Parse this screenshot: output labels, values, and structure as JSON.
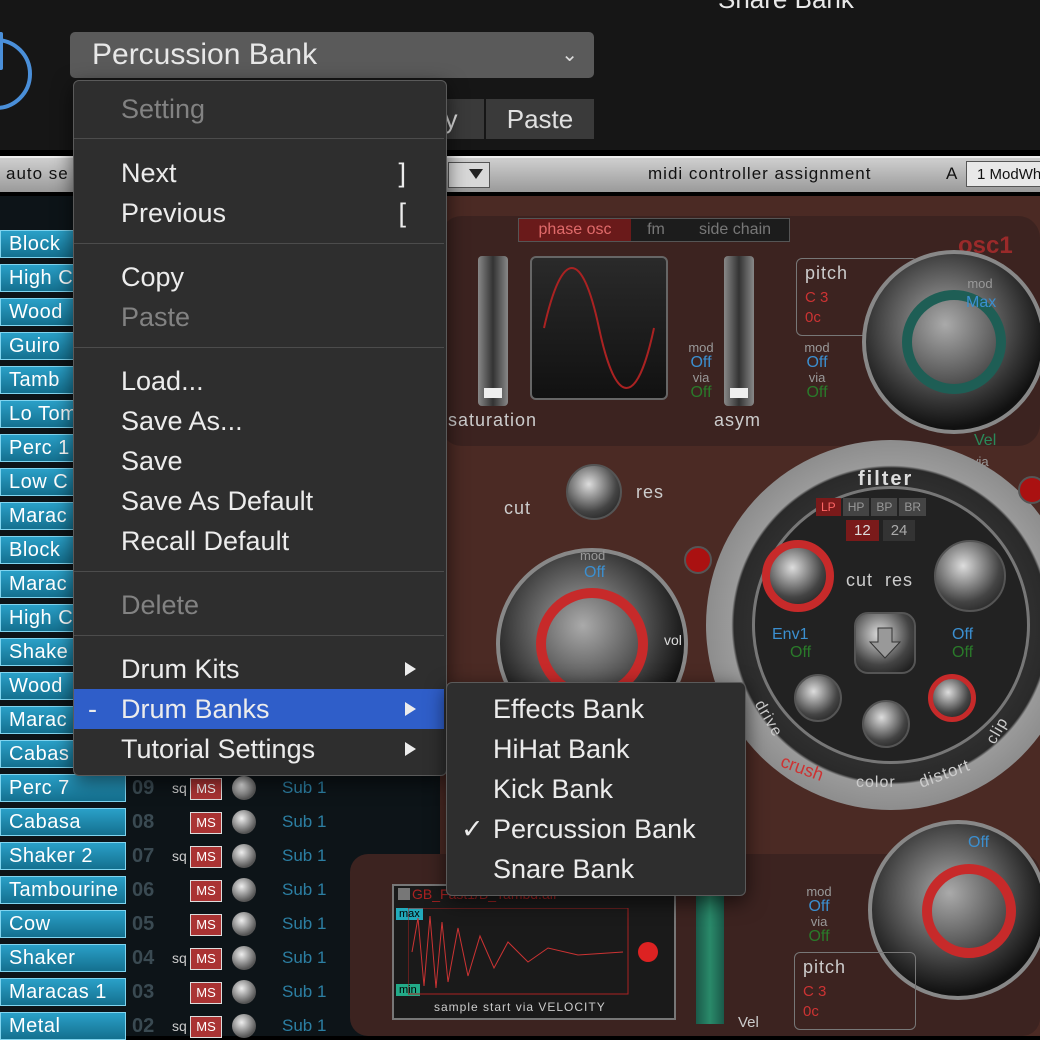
{
  "header": {
    "preset_name": "Percussion Bank",
    "snare_bank_top": "Snare Bank",
    "copy_label": "py",
    "paste_label": "Paste"
  },
  "toolbar": {
    "auto_select_label": "auto se",
    "midi_controller_label": "midi controller assignment",
    "midi_a_label": "A",
    "midi_controller_value": "1 ModWh"
  },
  "pads": [
    {
      "name": "Block",
      "num": "",
      "sq": "",
      "sub": ""
    },
    {
      "name": "High C",
      "num": "",
      "sq": "",
      "sub": ""
    },
    {
      "name": "Wood",
      "num": "",
      "sq": "",
      "sub": ""
    },
    {
      "name": "Guiro",
      "num": "",
      "sq": "",
      "sub": ""
    },
    {
      "name": "Tamb",
      "num": "",
      "sq": "",
      "sub": ""
    },
    {
      "name": "Lo Tom",
      "num": "",
      "sq": "",
      "sub": ""
    },
    {
      "name": "Perc 1",
      "num": "",
      "sq": "",
      "sub": ""
    },
    {
      "name": "Low C",
      "num": "",
      "sq": "",
      "sub": ""
    },
    {
      "name": "Marac",
      "num": "",
      "sq": "",
      "sub": ""
    },
    {
      "name": "Block",
      "num": "",
      "sq": "",
      "sub": ""
    },
    {
      "name": "Marac",
      "num": "",
      "sq": "",
      "sub": ""
    },
    {
      "name": "High C",
      "num": "",
      "sq": "",
      "sub": ""
    },
    {
      "name": "Shake",
      "num": "",
      "sq": "",
      "sub": ""
    },
    {
      "name": "Wood",
      "num": "",
      "sq": "",
      "sub": ""
    },
    {
      "name": "Marac",
      "num": "",
      "sq": "",
      "sub": ""
    },
    {
      "name": "Cabas",
      "num": "",
      "sq": "",
      "sub": ""
    },
    {
      "name": "Perc 7",
      "num": "09",
      "sq": "sq",
      "sub": "Sub 1"
    },
    {
      "name": "Cabasa",
      "num": "08",
      "sq": "",
      "sub": "Sub 1"
    },
    {
      "name": "Shaker 2",
      "num": "07",
      "sq": "sq",
      "sub": "Sub 1"
    },
    {
      "name": "Tambourine",
      "num": "06",
      "sq": "",
      "sub": "Sub 1"
    },
    {
      "name": "Cow",
      "num": "05",
      "sq": "",
      "sub": "Sub 1"
    },
    {
      "name": "Shaker",
      "num": "04",
      "sq": "sq",
      "sub": "Sub 1"
    },
    {
      "name": "Maracas 1",
      "num": "03",
      "sq": "",
      "sub": "Sub 1"
    },
    {
      "name": "Metal",
      "num": "02",
      "sq": "sq",
      "sub": "Sub 1"
    }
  ],
  "synth": {
    "tab_phase": "phase osc",
    "tab_fm": "fm",
    "tab_sidechain": "side chain",
    "osc1_label": "osc1",
    "saturation_label": "saturation",
    "asym_label": "asym",
    "mod_label": "mod",
    "off_label": "Off",
    "via_label": "via",
    "pitch_label": "pitch",
    "pitch_note": "C 3",
    "pitch_cents": "0c",
    "max_label": "Max",
    "vel_label": "Vel",
    "cut_label": "cut",
    "res_label": "res",
    "filter_label": "filter",
    "filter_types": [
      "LP",
      "HP",
      "BP",
      "BR"
    ],
    "slopes": [
      "12",
      "24"
    ],
    "cut_res_label": "cut  res",
    "env1_label": "Env1",
    "drive_label": "drive",
    "crush_label": "crush",
    "color_label": "color",
    "distort_label": "distort",
    "clip_label": "clip",
    "vol_label": "vol",
    "sample_file": "GB_Fast1/B_Tambd.aif",
    "sample_max": "max",
    "sample_min": "min",
    "sample_start_label": "sample start via VELOCITY"
  },
  "menu": {
    "items": [
      {
        "label": "Setting",
        "disabled": true
      },
      {
        "label": "Next",
        "shortcut": "]"
      },
      {
        "label": "Previous",
        "shortcut": "["
      },
      {
        "label": "Copy"
      },
      {
        "label": "Paste",
        "disabled": true
      },
      {
        "label": "Load..."
      },
      {
        "label": "Save As..."
      },
      {
        "label": "Save"
      },
      {
        "label": "Save As Default"
      },
      {
        "label": "Recall Default"
      },
      {
        "label": "Delete",
        "disabled": true
      },
      {
        "label": "Drum Kits",
        "submenu": true
      },
      {
        "label": "Drum Banks",
        "submenu": true,
        "selected": true,
        "prefix": "-"
      },
      {
        "label": "Tutorial Settings",
        "submenu": true
      }
    ]
  },
  "submenu": {
    "items": [
      {
        "label": "Effects Bank"
      },
      {
        "label": "HiHat Bank"
      },
      {
        "label": "Kick Bank"
      },
      {
        "label": "Percussion Bank",
        "checked": true,
        "check": "✓"
      },
      {
        "label": "Snare Bank"
      }
    ]
  },
  "colors": {
    "accent_selected": "#2f5ec9",
    "power_blue": "#4a8fd9",
    "pad_blue": "#2aa0c8",
    "synth_red": "#c72a2a"
  }
}
